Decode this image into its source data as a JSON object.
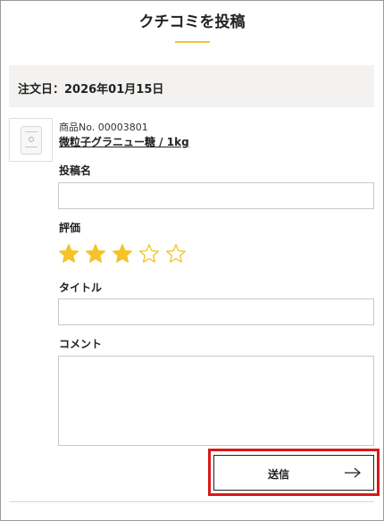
{
  "page": {
    "title": "クチコミを投稿"
  },
  "order": {
    "date_text": "注文日：2026年01月15日"
  },
  "product": {
    "number_text": "商品No. 00003801",
    "name": "微粒子グラニュー糖 / 1kg",
    "image_icon": "sugar-bag-icon"
  },
  "form": {
    "post_name": {
      "label": "投稿名",
      "value": "",
      "placeholder": ""
    },
    "rating": {
      "label": "評価",
      "value": 3,
      "max": 5,
      "filled_color": "#f5c227",
      "empty_color": "#f5c227"
    },
    "review_title": {
      "label": "タイトル",
      "value": "",
      "placeholder": ""
    },
    "comment": {
      "label": "コメント",
      "value": "",
      "placeholder": ""
    }
  },
  "submit": {
    "label": "送信",
    "arrow_icon": "arrow-right-icon"
  },
  "colors": {
    "accent": "#f2c23a",
    "highlight": "#d81818",
    "order_bar_bg": "#f3f2f1"
  }
}
